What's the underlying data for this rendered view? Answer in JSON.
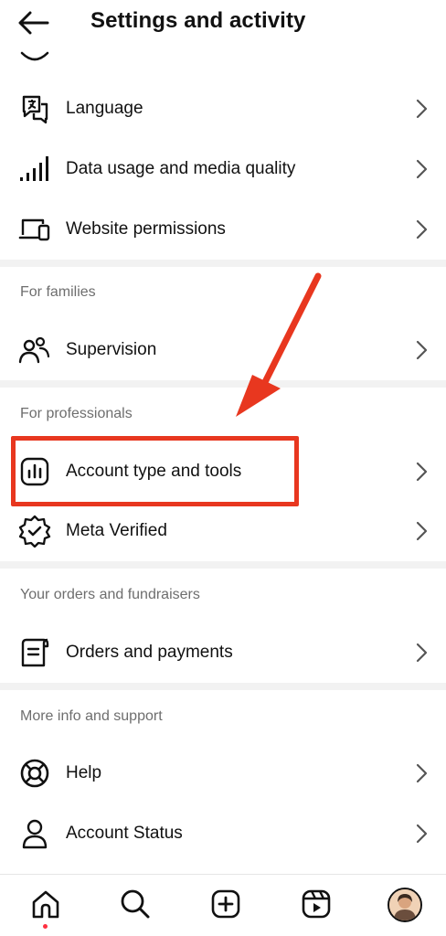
{
  "header": {
    "title": "Settings and activity",
    "back_icon": "back-arrow-icon"
  },
  "rows": {
    "language": "Language",
    "data_usage": "Data usage and media quality",
    "website_permissions": "Website permissions",
    "supervision": "Supervision",
    "account_type": "Account type and tools",
    "meta_verified": "Meta Verified",
    "orders": "Orders and payments",
    "help": "Help",
    "account_status": "Account Status"
  },
  "sections": {
    "families": "For families",
    "professionals": "For professionals",
    "orders": "Your orders and fundraisers",
    "support": "More info and support"
  },
  "colors": {
    "highlight": "#e8371f",
    "arrow": "#e8371f",
    "notification_dot": "#ff3040"
  },
  "bottom_nav": {
    "items": [
      "home-icon",
      "search-icon",
      "create-icon",
      "reels-icon",
      "profile-avatar"
    ]
  }
}
